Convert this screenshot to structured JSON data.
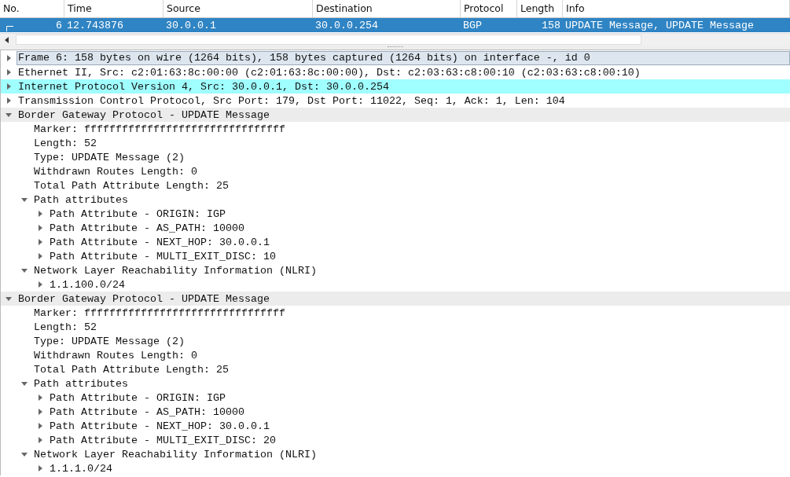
{
  "packet_list": {
    "columns": [
      "No.",
      "Time",
      "Source",
      "Destination",
      "Protocol",
      "Length",
      "Info"
    ],
    "rows": [
      {
        "selected": true,
        "cells": [
          "6",
          "12.743876",
          "30.0.0.1",
          "30.0.0.254",
          "BGP",
          "158",
          "UPDATE Message, UPDATE Message"
        ]
      }
    ]
  },
  "tree": [
    {
      "label": "Frame 6: 158 bytes on wire (1264 bits), 158 bytes captured (1264 bits) on interface -, id 0",
      "expanded": false,
      "selected": true
    },
    {
      "label": "Ethernet II, Src: c2:01:63:8c:00:00 (c2:01:63:8c:00:00), Dst: c2:03:63:c8:00:10 (c2:03:63:c8:00:10)",
      "expanded": false,
      "selected": false
    },
    {
      "label": "Internet Protocol Version 4, Src: 30.0.0.1, Dst: 30.0.0.254",
      "expanded": false,
      "selected": false,
      "color": "#a0ffff"
    },
    {
      "label": "Transmission Control Protocol, Src Port: 179, Dst Port: 11022, Seq: 1, Ack: 1, Len: 104",
      "expanded": false,
      "selected": false
    },
    {
      "label": "Border Gateway Protocol - UPDATE Message",
      "expanded": true,
      "selected": false,
      "children": [
        {
          "label": "Marker: ffffffffffffffffffffffffffffffff"
        },
        {
          "label": "Length: 52"
        },
        {
          "label": "Type: UPDATE Message (2)"
        },
        {
          "label": "Withdrawn Routes Length: 0"
        },
        {
          "label": "Total Path Attribute Length: 25"
        },
        {
          "label": "Path attributes",
          "expanded": true,
          "children": [
            {
              "label": "Path Attribute - ORIGIN: IGP",
              "expanded": false
            },
            {
              "label": "Path Attribute - AS_PATH: 10000",
              "expanded": false
            },
            {
              "label": "Path Attribute - NEXT_HOP: 30.0.0.1",
              "expanded": false
            },
            {
              "label": "Path Attribute - MULTI_EXIT_DISC: 10",
              "expanded": false
            }
          ]
        },
        {
          "label": "Network Layer Reachability Information (NLRI)",
          "expanded": true,
          "children": [
            {
              "label": "1.1.100.0/24",
              "expanded": false
            }
          ]
        }
      ]
    },
    {
      "label": "Border Gateway Protocol - UPDATE Message",
      "expanded": true,
      "selected": false,
      "children": [
        {
          "label": "Marker: ffffffffffffffffffffffffffffffff"
        },
        {
          "label": "Length: 52"
        },
        {
          "label": "Type: UPDATE Message (2)"
        },
        {
          "label": "Withdrawn Routes Length: 0"
        },
        {
          "label": "Total Path Attribute Length: 25"
        },
        {
          "label": "Path attributes",
          "expanded": true,
          "children": [
            {
              "label": "Path Attribute - ORIGIN: IGP",
              "expanded": false
            },
            {
              "label": "Path Attribute - AS_PATH: 10000",
              "expanded": false
            },
            {
              "label": "Path Attribute - NEXT_HOP: 30.0.0.1",
              "expanded": false
            },
            {
              "label": "Path Attribute - MULTI_EXIT_DISC: 20",
              "expanded": false
            }
          ]
        },
        {
          "label": "Network Layer Reachability Information (NLRI)",
          "expanded": true,
          "children": [
            {
              "label": "1.1.1.0/24",
              "expanded": false
            }
          ]
        }
      ]
    }
  ]
}
